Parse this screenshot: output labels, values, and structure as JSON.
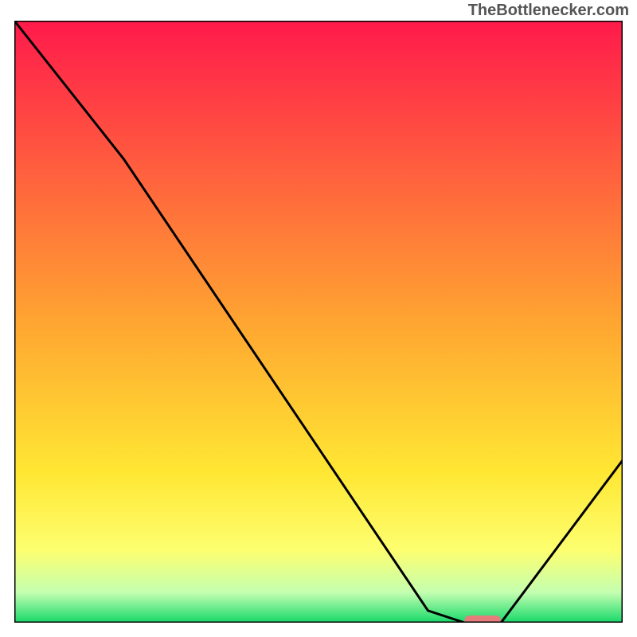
{
  "watermark": "TheBottlenecker.com",
  "chart_data": {
    "type": "line",
    "title": "",
    "xlabel": "",
    "ylabel": "",
    "xlim": [
      0,
      100
    ],
    "ylim": [
      0,
      100
    ],
    "series": [
      {
        "name": "curve",
        "x": [
          0,
          18,
          68,
          74,
          80,
          100
        ],
        "values": [
          100,
          77,
          2,
          0,
          0,
          27
        ]
      }
    ],
    "marker": {
      "x_range": [
        74,
        80
      ],
      "y": 0,
      "color": "#e77c7c"
    },
    "gradient": {
      "stops": [
        {
          "pos": 0.0,
          "color": "#ff1a4b"
        },
        {
          "pos": 0.5,
          "color": "#ffa531"
        },
        {
          "pos": 0.75,
          "color": "#ffe733"
        },
        {
          "pos": 0.88,
          "color": "#fdff70"
        },
        {
          "pos": 0.95,
          "color": "#c4ffb0"
        },
        {
          "pos": 1.0,
          "color": "#17d86a"
        }
      ]
    }
  }
}
